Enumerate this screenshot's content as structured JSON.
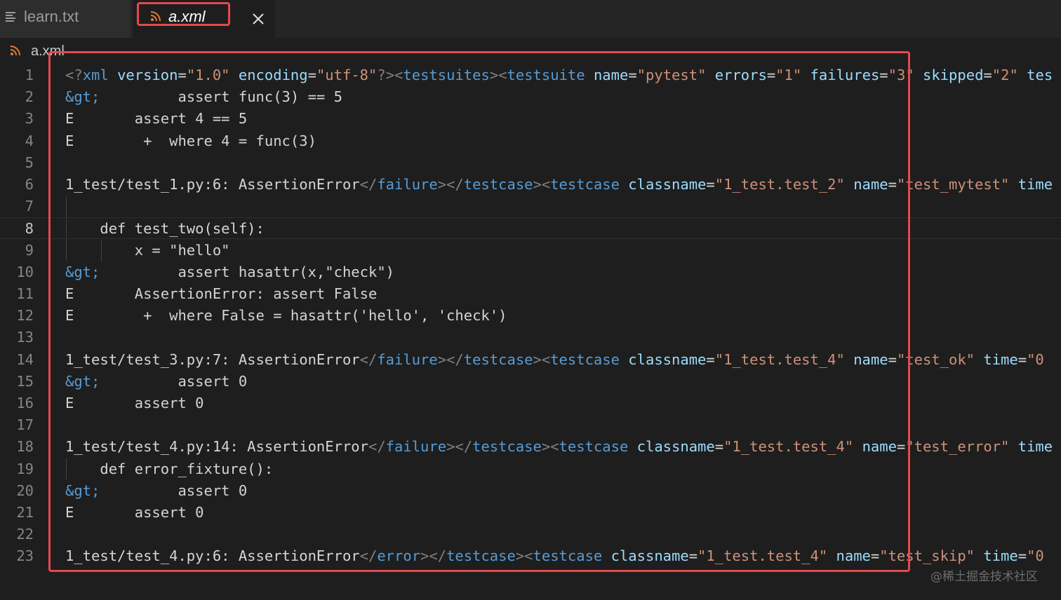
{
  "tabs": [
    {
      "label": "learn.txt",
      "icon": "lines-icon",
      "active": false
    },
    {
      "label": "a.xml",
      "icon": "rss-icon",
      "active": true
    }
  ],
  "breadcrumb": {
    "file": "a.xml",
    "icon": "rss-icon"
  },
  "colors": {
    "highlight": "#e5484d",
    "rss": "#e37933",
    "tag": "#569cd6",
    "attribute": "#9cdcfe",
    "string": "#ce9178",
    "punctuation": "#808080",
    "text": "#d4d4d4"
  },
  "editor": {
    "current_line": 8,
    "lines": [
      {
        "n": "1",
        "tokens": [
          {
            "t": "punc",
            "v": "<?"
          },
          {
            "t": "tag",
            "v": "xml"
          },
          {
            "t": "text",
            "v": " "
          },
          {
            "t": "attr",
            "v": "version"
          },
          {
            "t": "text",
            "v": "="
          },
          {
            "t": "str",
            "v": "\"1.0\""
          },
          {
            "t": "text",
            "v": " "
          },
          {
            "t": "attr",
            "v": "encoding"
          },
          {
            "t": "text",
            "v": "="
          },
          {
            "t": "str",
            "v": "\"utf-8\""
          },
          {
            "t": "punc",
            "v": "?><"
          },
          {
            "t": "tag",
            "v": "testsuites"
          },
          {
            "t": "punc",
            "v": "><"
          },
          {
            "t": "tag",
            "v": "testsuite"
          },
          {
            "t": "text",
            "v": " "
          },
          {
            "t": "attr",
            "v": "name"
          },
          {
            "t": "text",
            "v": "="
          },
          {
            "t": "str",
            "v": "\"pytest\""
          },
          {
            "t": "text",
            "v": " "
          },
          {
            "t": "attr",
            "v": "errors"
          },
          {
            "t": "text",
            "v": "="
          },
          {
            "t": "str",
            "v": "\"1\""
          },
          {
            "t": "text",
            "v": " "
          },
          {
            "t": "attr",
            "v": "failures"
          },
          {
            "t": "text",
            "v": "="
          },
          {
            "t": "str",
            "v": "\"3\""
          },
          {
            "t": "text",
            "v": " "
          },
          {
            "t": "attr",
            "v": "skipped"
          },
          {
            "t": "text",
            "v": "="
          },
          {
            "t": "str",
            "v": "\"2\""
          },
          {
            "t": "text",
            "v": " "
          },
          {
            "t": "attr",
            "v": "tes"
          }
        ]
      },
      {
        "n": "2",
        "tokens": [
          {
            "t": "ent",
            "v": "&gt;"
          },
          {
            "t": "text",
            "v": "         assert func(3) == 5"
          }
        ]
      },
      {
        "n": "3",
        "tokens": [
          {
            "t": "text",
            "v": "E       assert 4 == 5"
          }
        ]
      },
      {
        "n": "4",
        "tokens": [
          {
            "t": "text",
            "v": "E        +  where 4 = func(3)"
          }
        ]
      },
      {
        "n": "5",
        "tokens": []
      },
      {
        "n": "6",
        "tokens": [
          {
            "t": "text",
            "v": "1_test/test_1.py:6: AssertionError"
          },
          {
            "t": "punc",
            "v": "</"
          },
          {
            "t": "tag",
            "v": "failure"
          },
          {
            "t": "punc",
            "v": "></"
          },
          {
            "t": "tag",
            "v": "testcase"
          },
          {
            "t": "punc",
            "v": "><"
          },
          {
            "t": "tag",
            "v": "testcase"
          },
          {
            "t": "text",
            "v": " "
          },
          {
            "t": "attr",
            "v": "classname"
          },
          {
            "t": "text",
            "v": "="
          },
          {
            "t": "str",
            "v": "\"1_test.test_2\""
          },
          {
            "t": "text",
            "v": " "
          },
          {
            "t": "attr",
            "v": "name"
          },
          {
            "t": "text",
            "v": "="
          },
          {
            "t": "str",
            "v": "\"test_mytest\""
          },
          {
            "t": "text",
            "v": " "
          },
          {
            "t": "attr",
            "v": "time"
          }
        ]
      },
      {
        "n": "7",
        "tokens": []
      },
      {
        "n": "8",
        "tokens": [
          {
            "t": "text",
            "v": "    def test_two(self):"
          }
        ]
      },
      {
        "n": "9",
        "tokens": [
          {
            "t": "text",
            "v": "        x = \"hello\""
          }
        ]
      },
      {
        "n": "10",
        "tokens": [
          {
            "t": "ent",
            "v": "&gt;"
          },
          {
            "t": "text",
            "v": "         assert hasattr(x,\"check\")"
          }
        ]
      },
      {
        "n": "11",
        "tokens": [
          {
            "t": "text",
            "v": "E       AssertionError: assert False"
          }
        ]
      },
      {
        "n": "12",
        "tokens": [
          {
            "t": "text",
            "v": "E        +  where False = hasattr('hello', 'check')"
          }
        ]
      },
      {
        "n": "13",
        "tokens": []
      },
      {
        "n": "14",
        "tokens": [
          {
            "t": "text",
            "v": "1_test/test_3.py:7: AssertionError"
          },
          {
            "t": "punc",
            "v": "</"
          },
          {
            "t": "tag",
            "v": "failure"
          },
          {
            "t": "punc",
            "v": "></"
          },
          {
            "t": "tag",
            "v": "testcase"
          },
          {
            "t": "punc",
            "v": "><"
          },
          {
            "t": "tag",
            "v": "testcase"
          },
          {
            "t": "text",
            "v": " "
          },
          {
            "t": "attr",
            "v": "classname"
          },
          {
            "t": "text",
            "v": "="
          },
          {
            "t": "str",
            "v": "\"1_test.test_4\""
          },
          {
            "t": "text",
            "v": " "
          },
          {
            "t": "attr",
            "v": "name"
          },
          {
            "t": "text",
            "v": "="
          },
          {
            "t": "str",
            "v": "\"test_ok\""
          },
          {
            "t": "text",
            "v": " "
          },
          {
            "t": "attr",
            "v": "time"
          },
          {
            "t": "text",
            "v": "="
          },
          {
            "t": "str",
            "v": "\"0"
          }
        ]
      },
      {
        "n": "15",
        "tokens": [
          {
            "t": "ent",
            "v": "&gt;"
          },
          {
            "t": "text",
            "v": "         assert 0"
          }
        ]
      },
      {
        "n": "16",
        "tokens": [
          {
            "t": "text",
            "v": "E       assert 0"
          }
        ]
      },
      {
        "n": "17",
        "tokens": []
      },
      {
        "n": "18",
        "tokens": [
          {
            "t": "text",
            "v": "1_test/test_4.py:14: AssertionError"
          },
          {
            "t": "punc",
            "v": "</"
          },
          {
            "t": "tag",
            "v": "failure"
          },
          {
            "t": "punc",
            "v": "></"
          },
          {
            "t": "tag",
            "v": "testcase"
          },
          {
            "t": "punc",
            "v": "><"
          },
          {
            "t": "tag",
            "v": "testcase"
          },
          {
            "t": "text",
            "v": " "
          },
          {
            "t": "attr",
            "v": "classname"
          },
          {
            "t": "text",
            "v": "="
          },
          {
            "t": "str",
            "v": "\"1_test.test_4\""
          },
          {
            "t": "text",
            "v": " "
          },
          {
            "t": "attr",
            "v": "name"
          },
          {
            "t": "text",
            "v": "="
          },
          {
            "t": "str",
            "v": "\"test_error\""
          },
          {
            "t": "text",
            "v": " "
          },
          {
            "t": "attr",
            "v": "time"
          }
        ]
      },
      {
        "n": "19",
        "tokens": [
          {
            "t": "text",
            "v": "    def error_fixture():"
          }
        ]
      },
      {
        "n": "20",
        "tokens": [
          {
            "t": "ent",
            "v": "&gt;"
          },
          {
            "t": "text",
            "v": "         assert 0"
          }
        ]
      },
      {
        "n": "21",
        "tokens": [
          {
            "t": "text",
            "v": "E       assert 0"
          }
        ]
      },
      {
        "n": "22",
        "tokens": []
      },
      {
        "n": "23",
        "tokens": [
          {
            "t": "text",
            "v": "1_test/test_4.py:6: AssertionError"
          },
          {
            "t": "punc",
            "v": "</"
          },
          {
            "t": "tag",
            "v": "error"
          },
          {
            "t": "punc",
            "v": "></"
          },
          {
            "t": "tag",
            "v": "testcase"
          },
          {
            "t": "punc",
            "v": "><"
          },
          {
            "t": "tag",
            "v": "testcase"
          },
          {
            "t": "text",
            "v": " "
          },
          {
            "t": "attr",
            "v": "classname"
          },
          {
            "t": "text",
            "v": "="
          },
          {
            "t": "str",
            "v": "\"1_test.test_4\""
          },
          {
            "t": "text",
            "v": " "
          },
          {
            "t": "attr",
            "v": "name"
          },
          {
            "t": "text",
            "v": "="
          },
          {
            "t": "str",
            "v": "\"test_skip\""
          },
          {
            "t": "text",
            "v": " "
          },
          {
            "t": "attr",
            "v": "time"
          },
          {
            "t": "text",
            "v": "="
          },
          {
            "t": "str",
            "v": "\"0"
          }
        ]
      }
    ]
  },
  "watermark": "@稀土掘金技术社区"
}
